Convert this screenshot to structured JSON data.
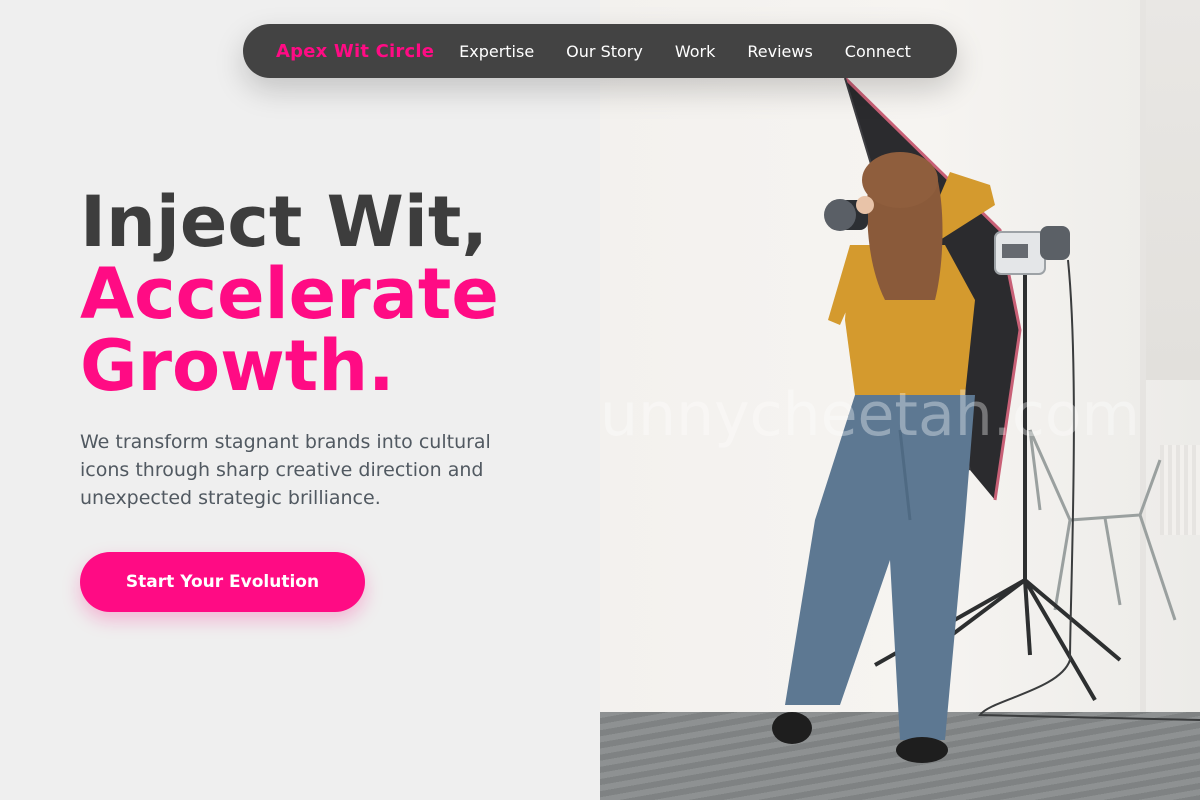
{
  "nav": {
    "brand": "Apex Wit Circle",
    "links": [
      "Expertise",
      "Our Story",
      "Work",
      "Reviews",
      "Connect"
    ]
  },
  "hero": {
    "headline_line1": "Inject Wit,",
    "headline_line2": "Accelerate",
    "headline_line3": "Growth.",
    "subtext": "We transform stagnant brands into cultural icons through sharp creative direction and unexpected strategic brilliance.",
    "cta_label": "Start Your Evolution"
  },
  "photo": {
    "watermark": "unnycheetah.com"
  },
  "colors": {
    "accent": "#ff0b84",
    "nav_bg": "#434343",
    "headline_dark": "#3d3d3d",
    "body_text": "#515961",
    "page_bg": "#efefef"
  },
  "icons": []
}
